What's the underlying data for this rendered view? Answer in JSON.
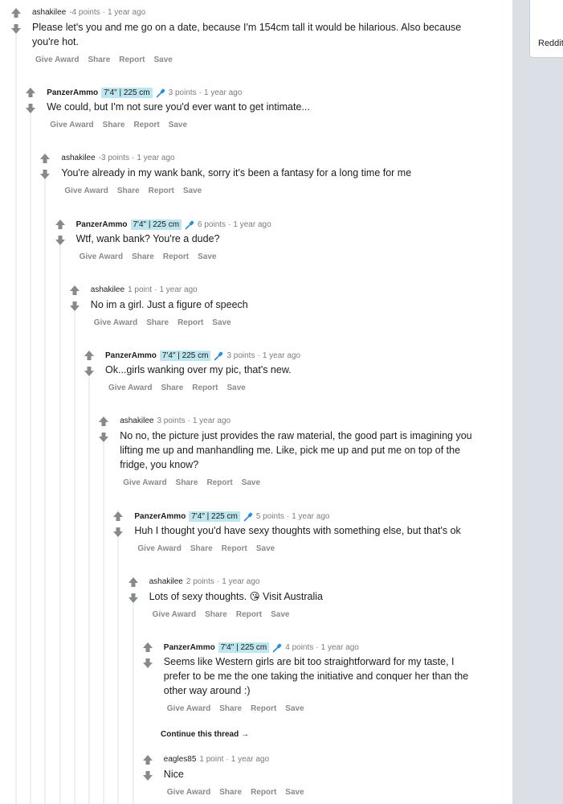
{
  "sidebar": {
    "label": "Reddit"
  },
  "actions": {
    "give_award": "Give Award",
    "share": "Share",
    "report": "Report",
    "save": "Save"
  },
  "comments": [
    {
      "author": "ashakilee",
      "flair": "",
      "points": "-4 points",
      "time": "1 year ago",
      "lines": [
        "Please let's you and me go on a date, because I'm 154cm tall it would be hilarious. Also because",
        "you're hot."
      ]
    },
    {
      "author": "PanzerAmmo",
      "flair": "7'4\" | 225 cm",
      "points": "3 points",
      "time": "1 year ago",
      "lines": [
        "We could, but I'm not sure you'd ever want to get intimate..."
      ]
    },
    {
      "author": "ashakilee",
      "flair": "",
      "points": "-3 points",
      "time": "1 year ago",
      "lines": [
        "You're already in my wank bank, sorry it's been a fantasy for a long time for me"
      ]
    },
    {
      "author": "PanzerAmmo",
      "flair": "7'4\" | 225 cm",
      "points": "6 points",
      "time": "1 year ago",
      "lines": [
        "Wtf, wank bank? You're a dude?"
      ]
    },
    {
      "author": "ashakilee",
      "flair": "",
      "points": "1 point",
      "time": "1 year ago",
      "lines": [
        "No im a girl. Just a figure of speech"
      ]
    },
    {
      "author": "PanzerAmmo",
      "flair": "7'4\" | 225 cm",
      "points": "3 points",
      "time": "1 year ago",
      "lines": [
        "Ok...girls wanking over my pic, that's new."
      ]
    },
    {
      "author": "ashakilee",
      "flair": "",
      "points": "3 points",
      "time": "1 year ago",
      "lines": [
        "No no, the picture just provides the raw material, the good part is imagining you",
        "lifting me up and manhandling me. Like, pick me up and put me on top of the",
        "fridge, you know?"
      ]
    },
    {
      "author": "PanzerAmmo",
      "flair": "7'4\" | 225 cm",
      "points": "5 points",
      "time": "1 year ago",
      "lines": [
        "Huh I thought you'd have sexy thoughts with something else, but that's ok"
      ]
    },
    {
      "author": "ashakilee",
      "flair": "",
      "points": "2 points",
      "time": "1 year ago",
      "lines": [
        "Lots of sexy thoughts. 😘 Visit Australia"
      ]
    },
    {
      "author": "PanzerAmmo",
      "flair": "7'4\" | 225 cm",
      "points": "4 points",
      "time": "1 year ago",
      "lines": [
        "Seems like Western girls are bit too straightforward for my taste, I",
        "prefer to be me the one taking the initiative and conquer her than the",
        "other way around :)"
      ]
    },
    {
      "author": "eagles85",
      "flair": "",
      "points": "1 point",
      "time": "1 year ago",
      "lines": [
        "Nice"
      ]
    }
  ],
  "continue_thread": "Continue this thread →"
}
